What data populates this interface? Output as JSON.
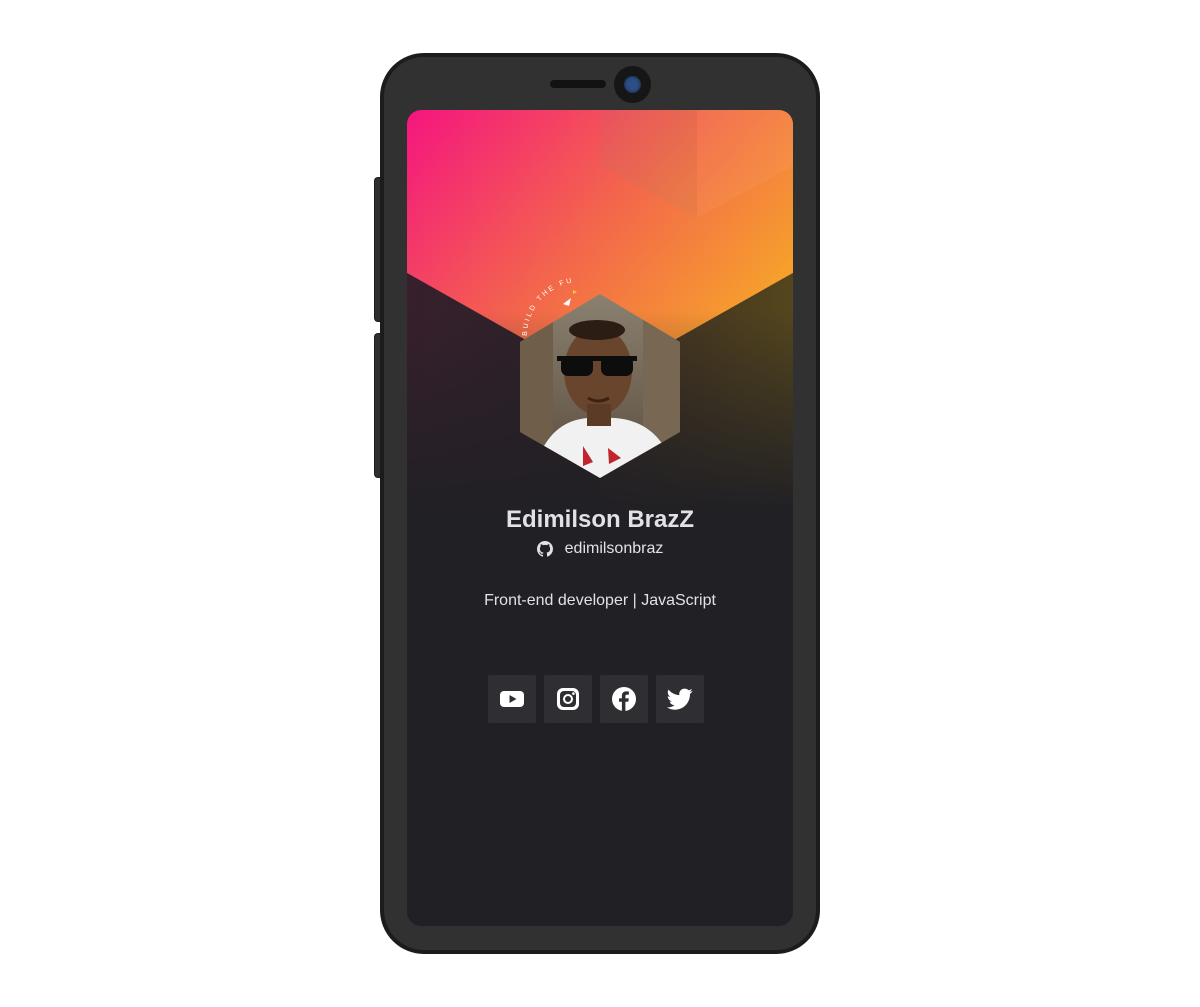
{
  "profile": {
    "name": "Edimilson BrazZ",
    "github_username": "edimilsonbraz",
    "bio": "Front-end developer | JavaScript",
    "badge_text": "BUILD THE FUTURE • ROCKETSEAT"
  },
  "socials": [
    {
      "icon": "youtube-icon"
    },
    {
      "icon": "instagram-icon"
    },
    {
      "icon": "facebook-icon"
    },
    {
      "icon": "twitter-icon"
    }
  ],
  "colors": {
    "gradient_start": "#f5157f",
    "gradient_end": "#f6a12c",
    "background": "#212024",
    "text": "#e1e1e6",
    "social_bg": "#2f2e33",
    "phone_frame": "#313131"
  }
}
